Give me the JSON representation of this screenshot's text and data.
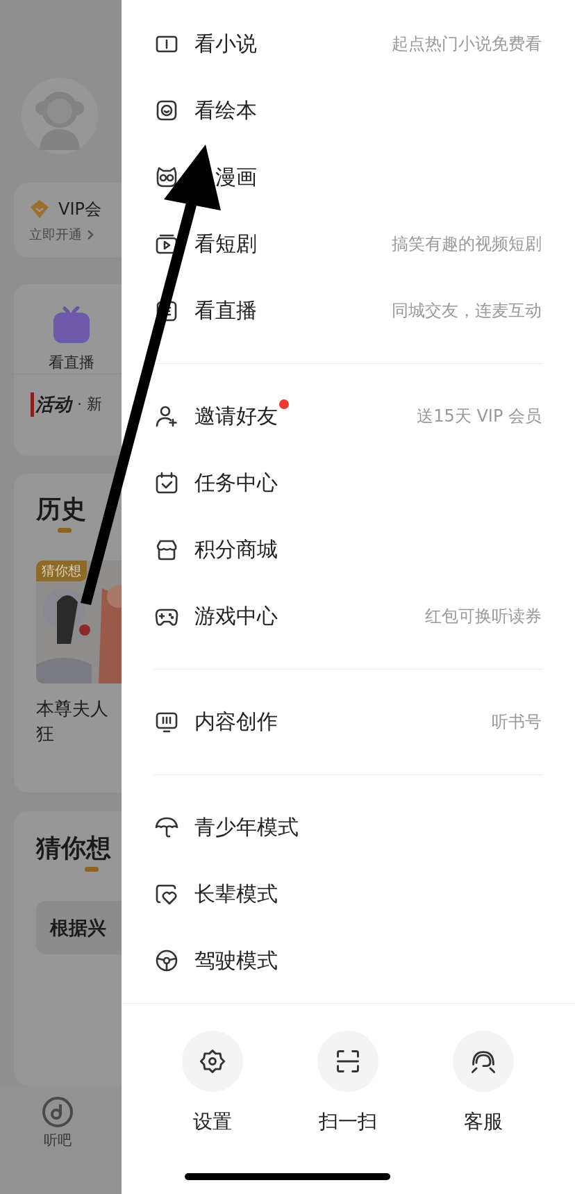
{
  "background_page": {
    "vip_card": {
      "title": "VIP会",
      "action": "立即开通"
    },
    "quick_entry": {
      "label": "看直播"
    },
    "activity": {
      "tag": "活动",
      "text": "· 新"
    },
    "history": {
      "title": "历史",
      "items": [
        {
          "kind": "picture",
          "badge": "猜你想",
          "title_lines": [
            "本尊夫人",
            "狂"
          ]
        }
      ]
    },
    "guess": {
      "title": "猜你想",
      "chip": "根据兴"
    },
    "tab_bar": {
      "items": [
        {
          "label": "听吧"
        }
      ]
    }
  },
  "drawer": {
    "sections": [
      [
        {
          "kind": "book",
          "label": "看小说",
          "hint": "起点热门小说免费看",
          "dot": false
        },
        {
          "kind": "baby",
          "label": "看绘本",
          "dot": false
        },
        {
          "kind": "cat",
          "label": "漫画",
          "dot": false
        },
        {
          "kind": "video",
          "label": "看短剧",
          "hint": "搞笑有趣的视频短剧",
          "dot": false
        },
        {
          "kind": "live",
          "label": "看直播",
          "hint": "同城交友，连麦互动",
          "dot": false
        }
      ],
      [
        {
          "kind": "person",
          "label": "邀请好友",
          "hint": "送15天 VIP 会员",
          "dot": true
        },
        {
          "kind": "calendar",
          "label": "任务中心",
          "dot": false
        },
        {
          "kind": "store",
          "label": "积分商城",
          "dot": false
        },
        {
          "kind": "gamepad",
          "label": "游戏中心",
          "hint": "红包可换听读券",
          "dot": false
        }
      ],
      [
        {
          "kind": "monitor",
          "label": "内容创作",
          "hint": "听书号",
          "dot": false
        }
      ],
      [
        {
          "kind": "umbrella",
          "label": "青少年模式",
          "dot": false
        },
        {
          "kind": "heart",
          "label": "长辈模式",
          "dot": false
        },
        {
          "kind": "wheel",
          "label": "驾驶模式",
          "dot": false
        }
      ]
    ],
    "bottom_actions": [
      {
        "kind": "gear",
        "label": "设置"
      },
      {
        "kind": "scan",
        "label": "扫一扫"
      },
      {
        "kind": "headset",
        "label": "客服"
      }
    ]
  }
}
